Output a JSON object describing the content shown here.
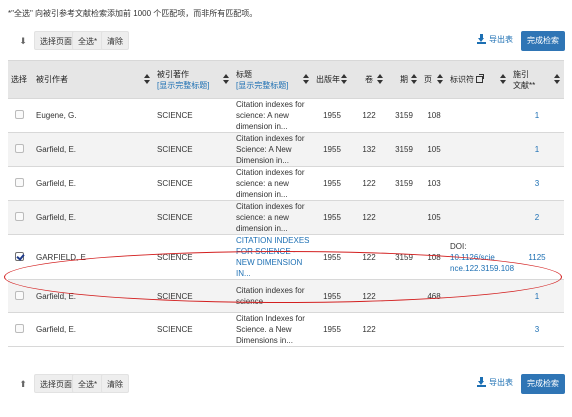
{
  "note": "*\"全选\" 向被引参考文献检索添加前 1000 个匹配项，而非所有匹配项。",
  "toolbar": {
    "select_page": "选择页面",
    "select_all": "全选*",
    "clear": "清除",
    "export": "导出表",
    "finish": "完成检索"
  },
  "columns": {
    "select": "选择",
    "cited_author": "被引作者",
    "cited_work": "被引著作",
    "cited_work_link": "[显示完整标题]",
    "title": "标题",
    "title_link": "[显示完整标题]",
    "year": "出版年",
    "volume": "卷",
    "issue": "期",
    "page": "页",
    "identifier": "标识符",
    "citing": "施引",
    "citing2": "文献**"
  },
  "rows": [
    {
      "author": "Eugene, G.",
      "work": "SCIENCE",
      "title": "Citation indexes for science: A new dimension in...",
      "year": "1955",
      "volume": "122",
      "issue": "3159",
      "page": "108",
      "id": "",
      "citing": "1",
      "checked": false
    },
    {
      "author": "Garfield, E.",
      "work": "SCIENCE",
      "title": "Citation indexes for Science: A New Dimension in...",
      "year": "1955",
      "volume": "132",
      "issue": "3159",
      "page": "105",
      "id": "",
      "citing": "1",
      "checked": false
    },
    {
      "author": "Garfield, E.",
      "work": "SCIENCE",
      "title": "Citation indexes for science: a new dimension in...",
      "year": "1955",
      "volume": "122",
      "issue": "3159",
      "page": "103",
      "id": "",
      "citing": "3",
      "checked": false
    },
    {
      "author": "Garfield, E.",
      "work": "SCIENCE",
      "title": "Citation indexes for science: a new dimension in...",
      "year": "1955",
      "volume": "122",
      "issue": "",
      "page": "105",
      "id": "",
      "citing": "2",
      "checked": false
    },
    {
      "author": "GARFIELD, E",
      "work": "SCIENCE",
      "title": "CITATION INDEXES FOR SCIENCE - NEW DIMENSION IN...",
      "year": "1955",
      "volume": "122",
      "issue": "3159",
      "page": "108",
      "id": "DOI: 10.1126/science.122.3159.108",
      "id_prefix": "DOI: ",
      "id_value": "10.1126/scie nce.122.3159.108",
      "citing": "1125",
      "checked": true
    },
    {
      "author": "Garfield, E.",
      "work": "SCIENCE",
      "title": "Citation indexes for science",
      "year": "1955",
      "volume": "122",
      "issue": "",
      "page": "468",
      "id": "",
      "citing": "1",
      "checked": false
    },
    {
      "author": "Garfield, E.",
      "work": "SCIENCE",
      "title": "Citation Indexes for Science. a New Dimensions in...",
      "year": "1955",
      "volume": "122",
      "issue": "",
      "page": "",
      "id": "",
      "citing": "3",
      "checked": false
    }
  ]
}
